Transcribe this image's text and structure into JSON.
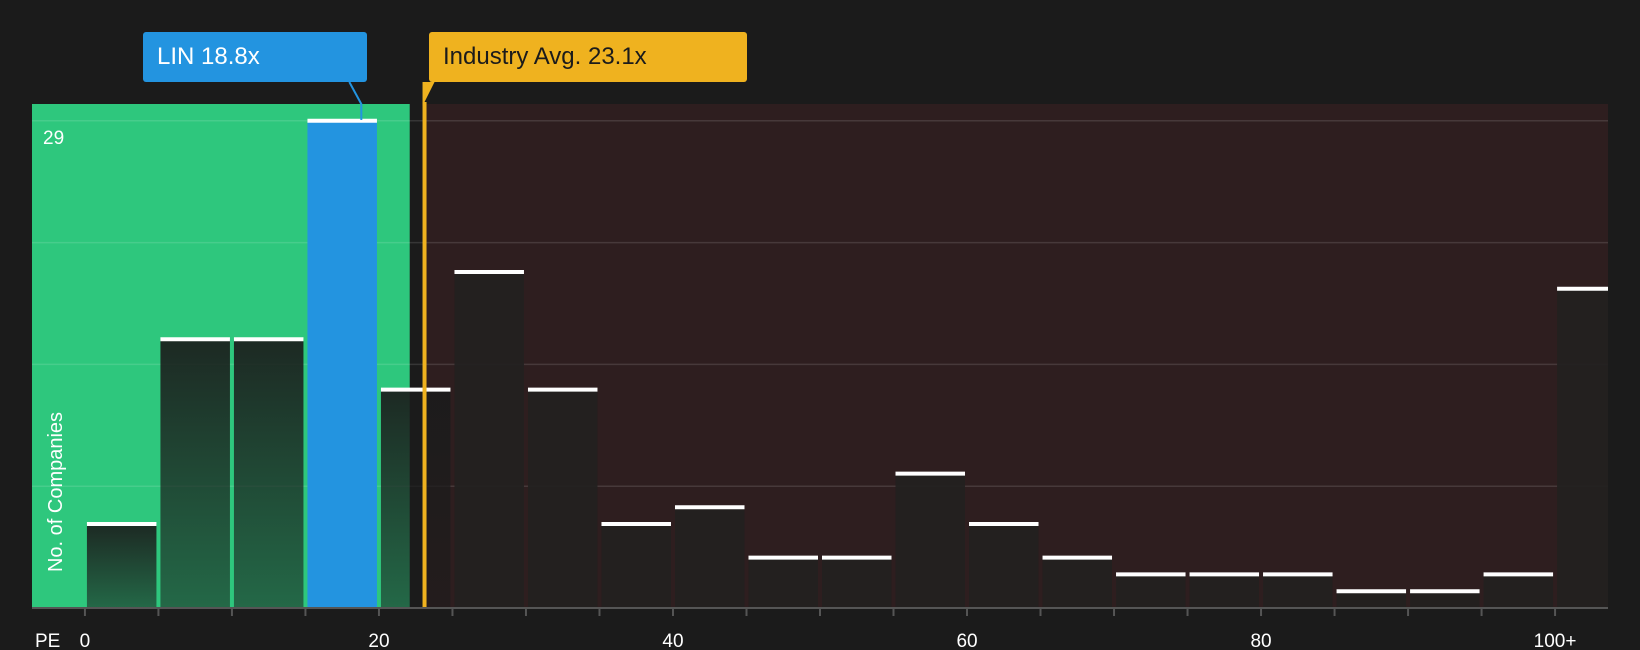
{
  "chart_data": {
    "type": "bar",
    "y_max_label": "29",
    "ylabel": "No. of Companies",
    "xlabel": "PE",
    "bin_width": 5,
    "x_range": [
      -3.6,
      103.6
    ],
    "ylim": [
      0,
      30
    ],
    "x_ticks": [
      {
        "value": 0,
        "label": "0"
      },
      {
        "value": 20,
        "label": "20"
      },
      {
        "value": 40,
        "label": "40"
      },
      {
        "value": 60,
        "label": "60"
      },
      {
        "value": 80,
        "label": "80"
      },
      {
        "value": 100,
        "label": "100+"
      }
    ],
    "bins": [
      {
        "start": 0,
        "count": 5
      },
      {
        "start": 5,
        "count": 16
      },
      {
        "start": 10,
        "count": 16
      },
      {
        "start": 15,
        "count": 29
      },
      {
        "start": 20,
        "count": 13
      },
      {
        "start": 25,
        "count": 20
      },
      {
        "start": 30,
        "count": 13
      },
      {
        "start": 35,
        "count": 5
      },
      {
        "start": 40,
        "count": 6
      },
      {
        "start": 45,
        "count": 3
      },
      {
        "start": 50,
        "count": 3
      },
      {
        "start": 55,
        "count": 8
      },
      {
        "start": 60,
        "count": 5
      },
      {
        "start": 65,
        "count": 3
      },
      {
        "start": 70,
        "count": 2
      },
      {
        "start": 75,
        "count": 2
      },
      {
        "start": 80,
        "count": 2
      },
      {
        "start": 85,
        "count": 1
      },
      {
        "start": 90,
        "count": 1
      },
      {
        "start": 95,
        "count": 2
      },
      {
        "start": 100,
        "count": 19
      }
    ],
    "company": {
      "label": "LIN 18.8x",
      "value": 18.8,
      "highlight_bin": 15
    },
    "industry_avg": {
      "label": "Industry Avg. 23.1x",
      "value": 23.1
    },
    "fair_zone_end": 22.1,
    "colors": {
      "background": "#1b1b1b",
      "fair_zone": "#2ec77d",
      "expensive_zone": "#2e1e1f",
      "company": "#2394e0",
      "industry": "#efb21f",
      "bar_top": "#ffffff"
    }
  }
}
